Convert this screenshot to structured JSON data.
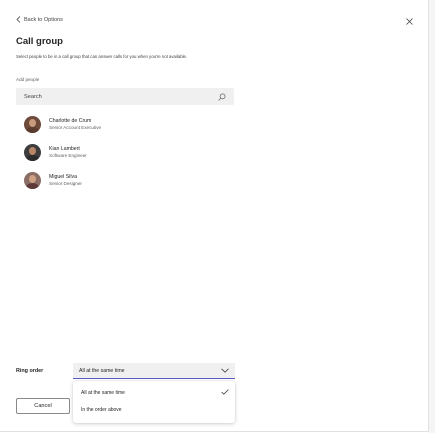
{
  "header": {
    "back_label": "Back to Options",
    "title": "Call group",
    "subtitle": "Select people to be in a call group that can answer calls for you when you're not available."
  },
  "add_people": {
    "label": "Add people",
    "search_placeholder": "Search"
  },
  "people": [
    {
      "name": "Charlotte de Crum",
      "role": "Senior Account Executive",
      "avatar_skin": "#c99a7c",
      "avatar_shirt": "#5a3b2e",
      "avatar_bg": "#6e4a3a"
    },
    {
      "name": "Kian Lambert",
      "role": "Software Engineer",
      "avatar_skin": "#b88566",
      "avatar_shirt": "#2b2b2b",
      "avatar_bg": "#3d3d3d"
    },
    {
      "name": "Miguel Silva",
      "role": "Senior Designer",
      "avatar_skin": "#d0a083",
      "avatar_shirt": "#5e3a3a",
      "avatar_bg": "#8a6d64"
    }
  ],
  "ring_order": {
    "label": "Ring order",
    "selected": "All at the same time",
    "options": [
      "All at the same time",
      "In the order above"
    ]
  },
  "footer": {
    "cancel_label": "Cancel"
  },
  "colors": {
    "accent": "#5b5fc7",
    "input_bg": "#f0f0f0"
  },
  "icons": {
    "back": "chevron-left-icon",
    "close": "close-icon",
    "search": "search-icon",
    "select": "chevron-down-icon",
    "selected": "checkmark-icon"
  }
}
